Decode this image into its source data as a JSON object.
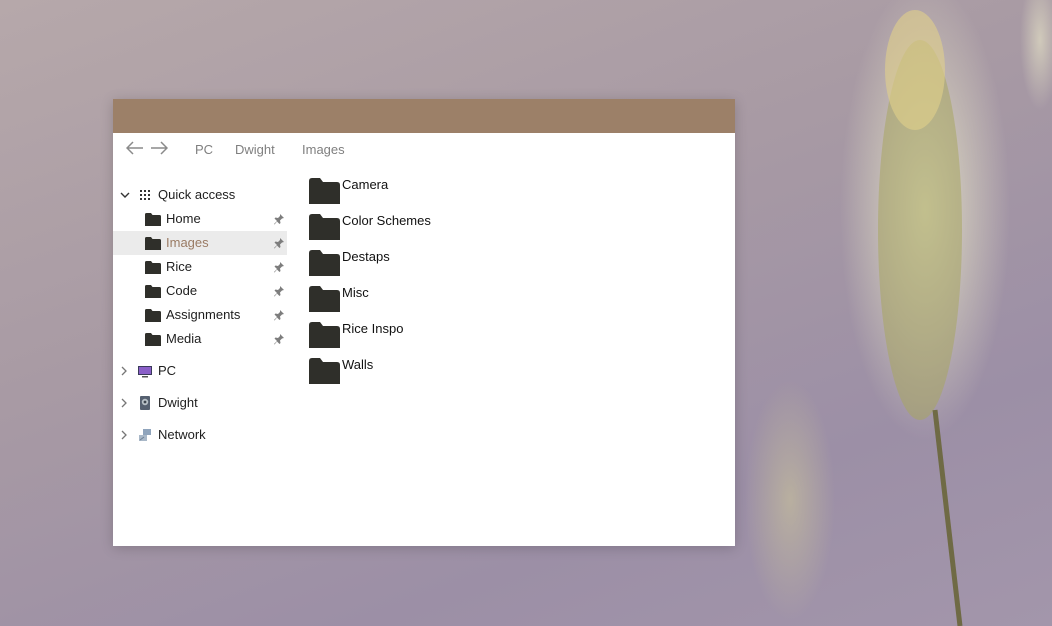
{
  "window": {
    "nav": {
      "back_icon": "arrow-left-icon",
      "forward_icon": "arrow-right-icon",
      "breadcrumb": [
        "PC",
        "Dwight",
        "Images"
      ]
    },
    "sidebar": {
      "quick_access": {
        "label": "Quick access",
        "expanded": true,
        "items": [
          {
            "label": "Home",
            "pinned": true,
            "selected": false
          },
          {
            "label": "Images",
            "pinned": true,
            "selected": true
          },
          {
            "label": "Rice",
            "pinned": true,
            "selected": false
          },
          {
            "label": "Code",
            "pinned": true,
            "selected": false
          },
          {
            "label": "Assignments",
            "pinned": true,
            "selected": false
          },
          {
            "label": "Media",
            "pinned": true,
            "selected": false
          }
        ]
      },
      "tree": [
        {
          "label": "PC",
          "icon": "monitor-icon"
        },
        {
          "label": "Dwight",
          "icon": "user-drive-icon"
        },
        {
          "label": "Network",
          "icon": "network-icon"
        }
      ]
    },
    "content": {
      "folders": [
        "Camera",
        "Color Schemes",
        "Destaps",
        "Misc",
        "Rice Inspo",
        "Walls"
      ]
    }
  },
  "colors": {
    "titlebar": "#9c8068",
    "selected_text": "#9a7b64",
    "selected_bg": "#ebebeb",
    "folder": "#2f2f2a"
  }
}
